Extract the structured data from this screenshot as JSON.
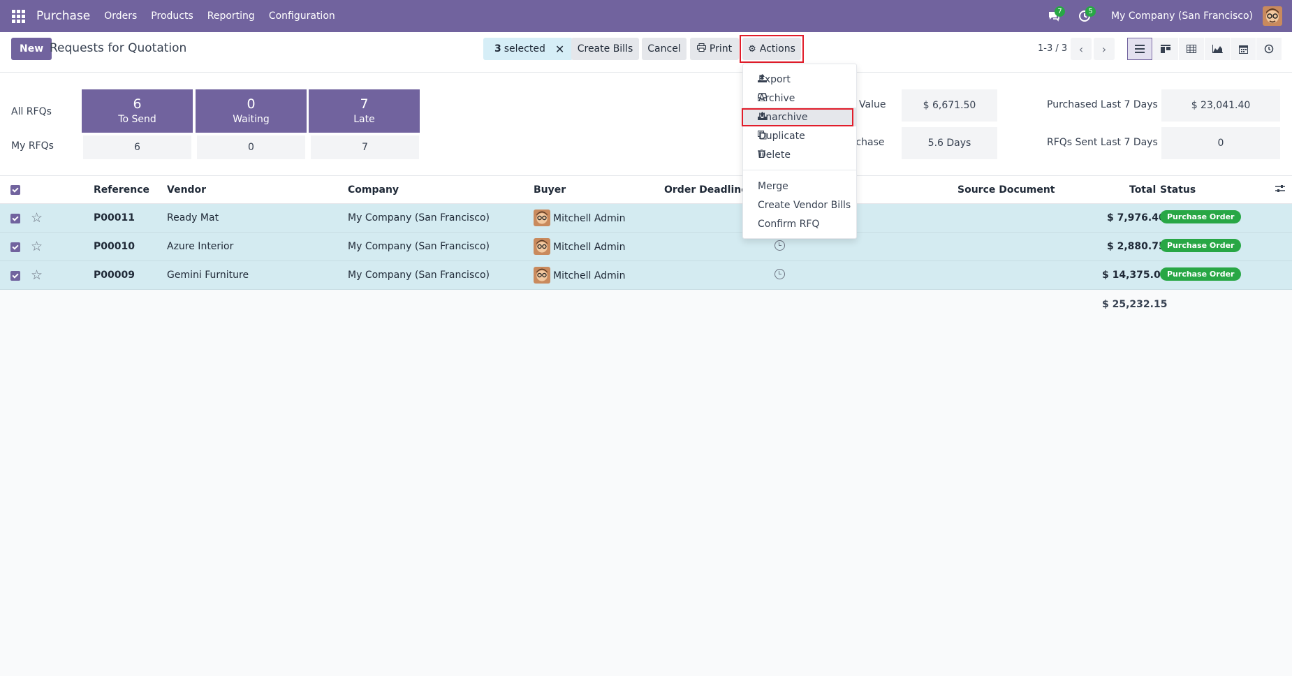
{
  "navbar": {
    "brand": "Purchase",
    "menu": [
      "Orders",
      "Products",
      "Reporting",
      "Configuration"
    ],
    "messages_count": "7",
    "activities_count": "5",
    "company": "My Company (San Francisco)"
  },
  "control": {
    "new_label": "New",
    "title": "Requests for Quotation",
    "selected_count": "3",
    "selected_label": "selected",
    "create_bills": "Create Bills",
    "cancel": "Cancel",
    "print": "Print",
    "actions": "Actions",
    "pager": "1-3 / 3"
  },
  "dashboard": {
    "all_rfqs": "All RFQs",
    "my_rfqs": "My RFQs",
    "tiles": [
      {
        "num": "6",
        "label": "To Send",
        "mine": "6"
      },
      {
        "num": "0",
        "label": "Waiting",
        "mine": "0"
      },
      {
        "num": "7",
        "label": "Late",
        "mine": "7"
      }
    ],
    "stat_value_label": "Value",
    "stat_value": "$ 6,671.50",
    "stat_purchase_label": "rchase",
    "stat_purchase": "5.6 Days",
    "purchased_label": "Purchased Last 7 Days",
    "purchased_value": "$ 23,041.40",
    "sent_label": "RFQs Sent Last 7 Days",
    "sent_value": "0"
  },
  "table": {
    "headers": {
      "reference": "Reference",
      "vendor": "Vendor",
      "company": "Company",
      "buyer": "Buyer",
      "deadline": "Order Deadline",
      "source": "Source Document",
      "total": "Total",
      "status": "Status"
    },
    "rows": [
      {
        "ref": "P00011",
        "vendor": "Ready Mat",
        "company": "My Company (San Francisco)",
        "buyer": "Mitchell Admin",
        "total": "$ 7,976.40",
        "status": "Purchase Order"
      },
      {
        "ref": "P00010",
        "vendor": "Azure Interior",
        "company": "My Company (San Francisco)",
        "buyer": "Mitchell Admin",
        "total": "$ 2,880.75",
        "status": "Purchase Order"
      },
      {
        "ref": "P00009",
        "vendor": "Gemini Furniture",
        "company": "My Company (San Francisco)",
        "buyer": "Mitchell Admin",
        "total": "$ 14,375.00",
        "status": "Purchase Order"
      }
    ],
    "grand_total": "$ 25,232.15"
  },
  "actions_menu": {
    "export": "Export",
    "archive": "Archive",
    "unarchive": "Unarchive",
    "duplicate": "Duplicate",
    "delete": "Delete",
    "merge": "Merge",
    "create_vendor_bills": "Create Vendor Bills",
    "confirm_rfq": "Confirm RFQ"
  },
  "colors": {
    "brand": "#71639e",
    "selected_row": "#d4ebf1",
    "status_green": "#28a745",
    "highlight_red": "#e11d2a"
  }
}
